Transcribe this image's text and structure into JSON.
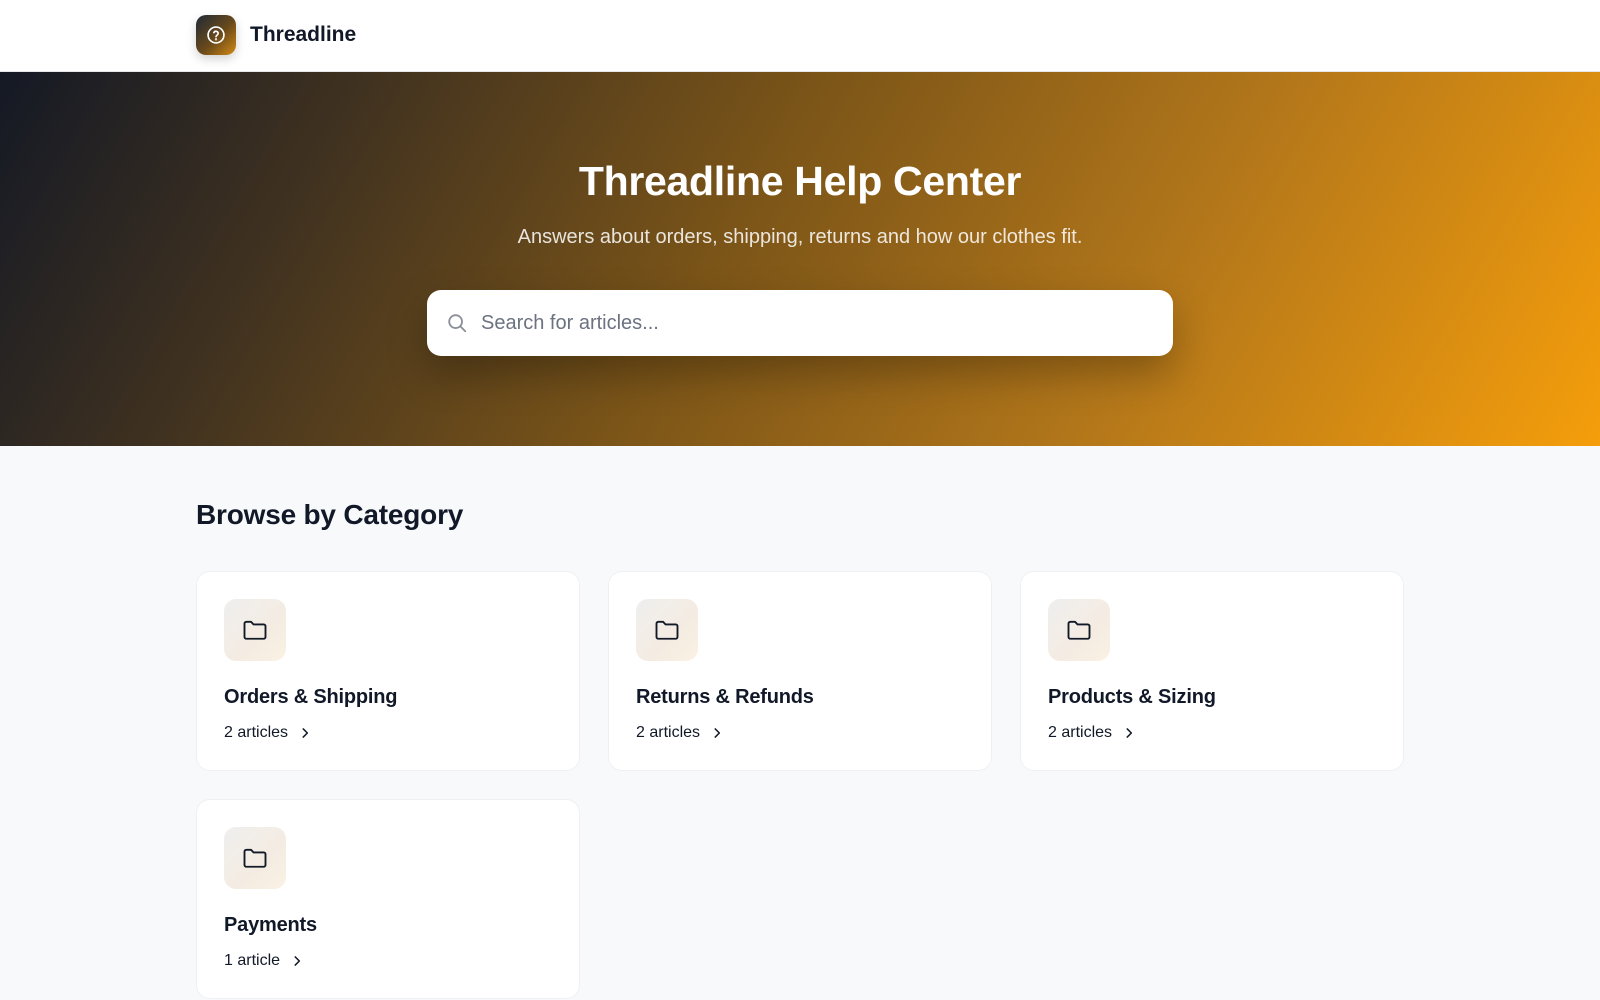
{
  "header": {
    "brand_name": "Threadline",
    "logo_icon": "help-circle-icon"
  },
  "hero": {
    "title": "Threadline Help Center",
    "subtitle": "Answers about orders, shipping, returns and how our clothes fit.",
    "search": {
      "placeholder": "Search for articles...",
      "value": "",
      "icon": "search-icon"
    }
  },
  "browse": {
    "title": "Browse by Category",
    "categories": [
      {
        "title": "Orders & Shipping",
        "count": "2 articles",
        "icon": "folder-icon"
      },
      {
        "title": "Returns & Refunds",
        "count": "2 articles",
        "icon": "folder-icon"
      },
      {
        "title": "Products & Sizing",
        "count": "2 articles",
        "icon": "folder-icon"
      },
      {
        "title": "Payments",
        "count": "1 article",
        "icon": "folder-icon"
      }
    ]
  },
  "colors": {
    "accent": "#f59e0b",
    "hero_dark": "#141925",
    "text": "#111827",
    "page_bg": "#f8f9fb"
  }
}
